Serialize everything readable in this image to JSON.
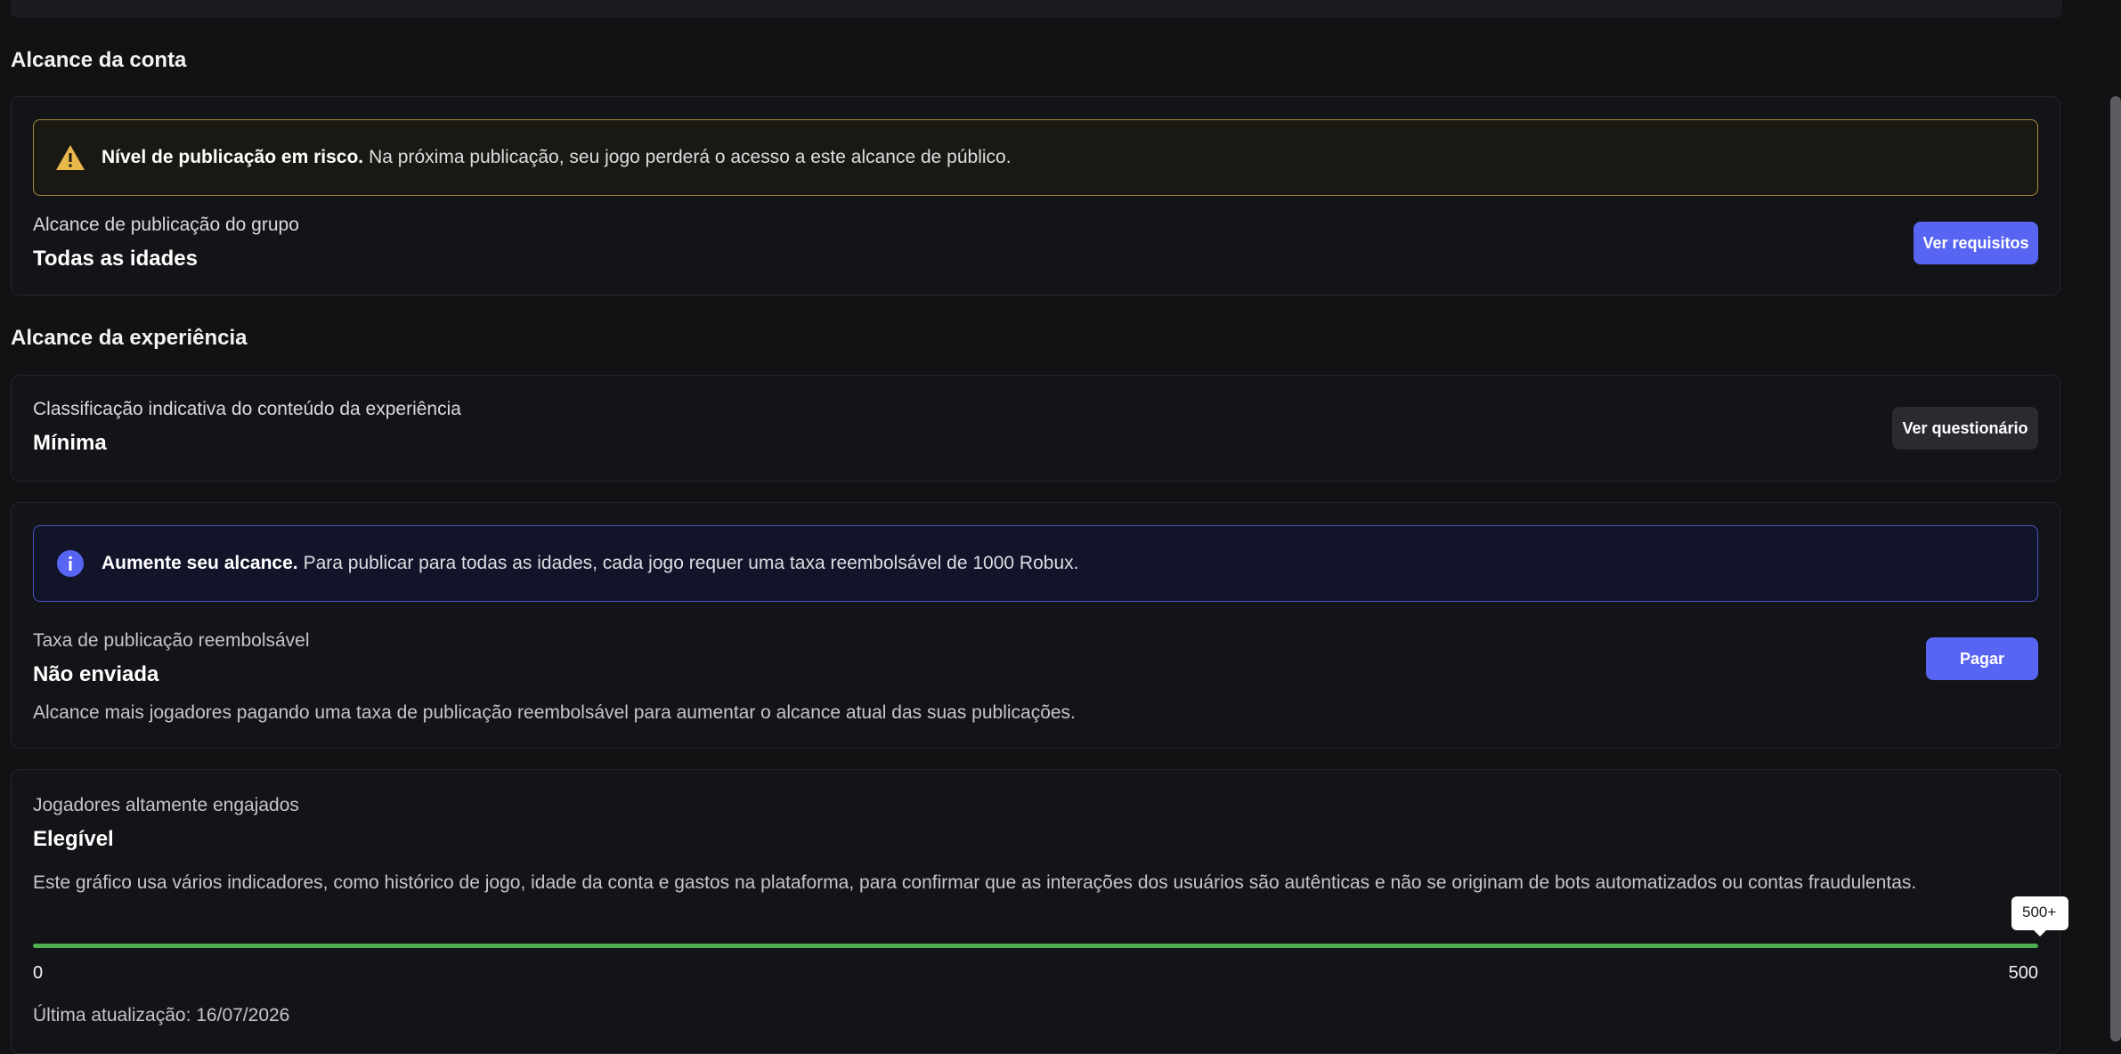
{
  "account_reach": {
    "section_title": "Alcance da conta",
    "warning": {
      "bold": "Nível de publicação em risco.",
      "text": "Na próxima publicação, seu jogo perderá o acesso a este alcance de público."
    },
    "label": "Alcance de publicação do grupo",
    "value": "Todas as idades",
    "button": "Ver requisitos"
  },
  "experience_reach": {
    "section_title": "Alcance da experiência",
    "rating_label": "Classificação indicativa do conteúdo da experiência",
    "rating_value": "Mínima",
    "rating_button": "Ver questionário",
    "info": {
      "bold": "Aumente seu alcance.",
      "text": "Para publicar para todas as idades, cada jogo requer uma taxa reembolsável de 1000 Robux."
    },
    "fee_label": "Taxa de publicação reembolsável",
    "fee_value": "Não enviada",
    "fee_button": "Pagar",
    "fee_desc": "Alcance mais jogadores pagando uma taxa de publicação reembolsável para aumentar o alcance atual das suas publicações."
  },
  "engaged": {
    "label": "Jogadores altamente engajados",
    "value": "Elegível",
    "desc": "Este gráfico usa vários indicadores, como histórico de jogo, idade da conta e gastos na plataforma, para confirmar que as interações dos usuários são autênticas e não se originam de bots automatizados ou contas fraudulentas.",
    "progress_fraction": 1.0,
    "min_label": "0",
    "max_label": "500",
    "tooltip": "500+",
    "updated": "Última atualização: 16/07/2026",
    "color": "#4caf50"
  },
  "colors": {
    "accent": "#5865f2",
    "warning": "#e8b84a",
    "background": "#121215"
  }
}
